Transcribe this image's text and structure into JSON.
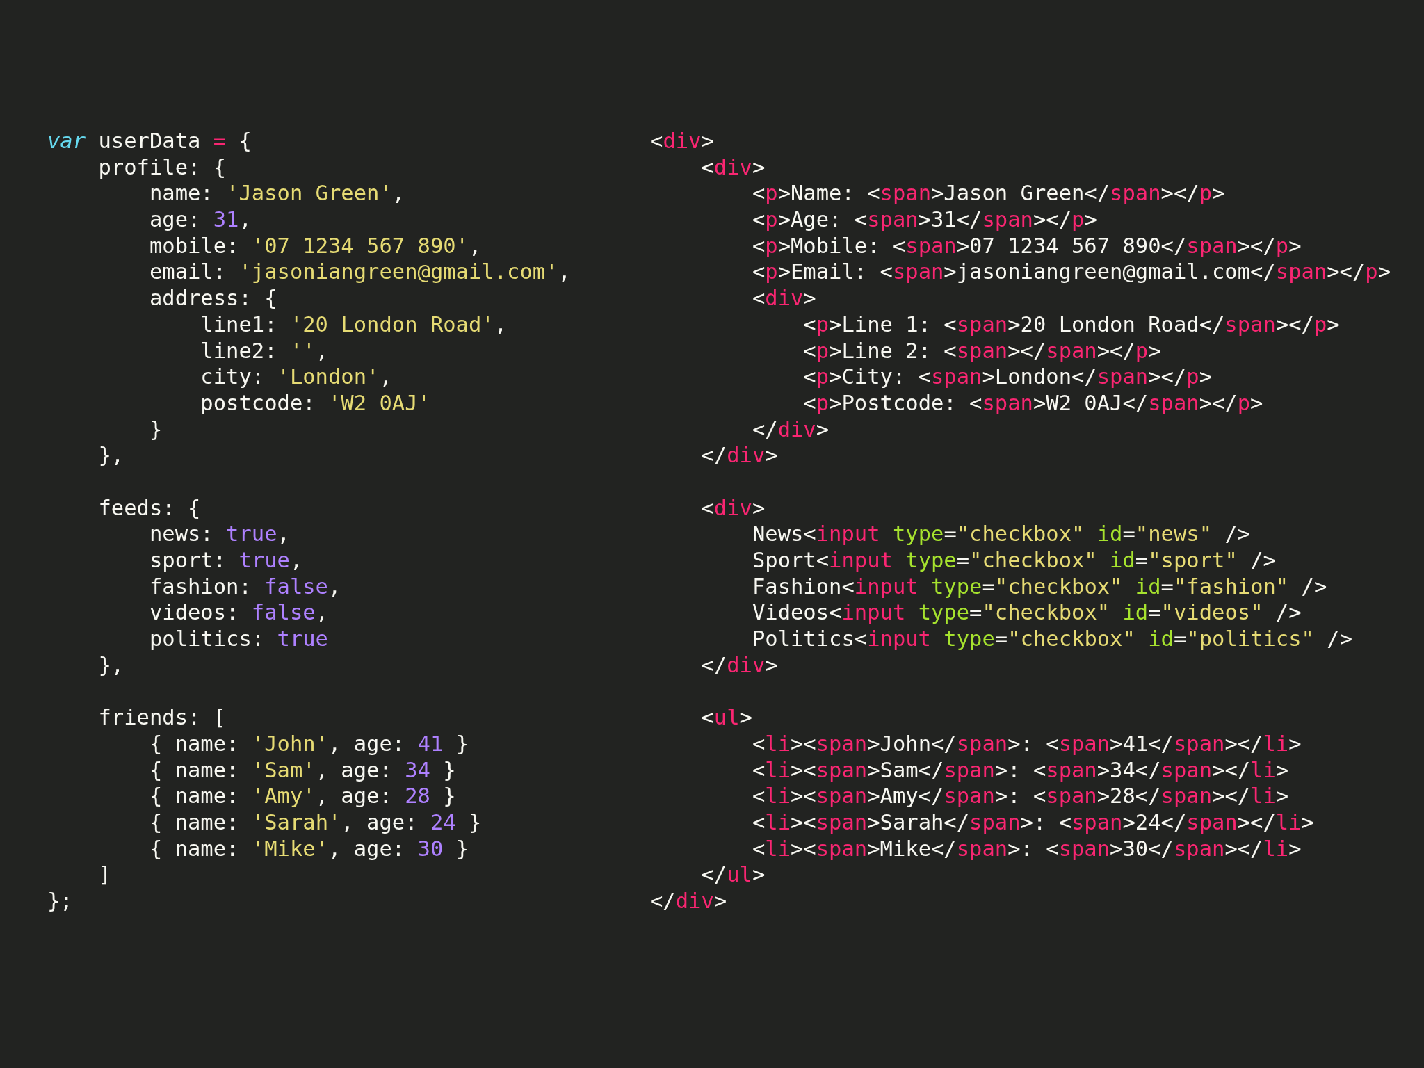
{
  "panes": [
    {
      "blocks": [
        {
          "lines": [
            {
              "tokens": [
                {
                  "kind": "keyword",
                  "text": "var"
                },
                {
                  "kind": "plain",
                  "text": " userData "
                },
                {
                  "kind": "operator",
                  "text": "="
                },
                {
                  "kind": "plain",
                  "text": " {"
                }
              ]
            },
            {
              "tokens": [
                {
                  "kind": "plain",
                  "text": "    profile: {"
                }
              ]
            },
            {
              "tokens": [
                {
                  "kind": "plain",
                  "text": "        name: "
                },
                {
                  "kind": "string",
                  "text": "'Jason Green'"
                },
                {
                  "kind": "plain",
                  "text": ","
                }
              ]
            },
            {
              "tokens": [
                {
                  "kind": "plain",
                  "text": "        age: "
                },
                {
                  "kind": "constant",
                  "text": "31"
                },
                {
                  "kind": "plain",
                  "text": ","
                }
              ]
            },
            {
              "tokens": [
                {
                  "kind": "plain",
                  "text": "        mobile: "
                },
                {
                  "kind": "string",
                  "text": "'07 1234 567 890'"
                },
                {
                  "kind": "plain",
                  "text": ","
                }
              ]
            },
            {
              "tokens": [
                {
                  "kind": "plain",
                  "text": "        email: "
                },
                {
                  "kind": "string",
                  "text": "'jasoniangreen@gmail.com'"
                },
                {
                  "kind": "plain",
                  "text": ","
                }
              ]
            },
            {
              "tokens": [
                {
                  "kind": "plain",
                  "text": "        address: {"
                }
              ]
            },
            {
              "tokens": [
                {
                  "kind": "plain",
                  "text": "            line1: "
                },
                {
                  "kind": "string",
                  "text": "'20 London Road'"
                },
                {
                  "kind": "plain",
                  "text": ","
                }
              ]
            },
            {
              "tokens": [
                {
                  "kind": "plain",
                  "text": "            line2: "
                },
                {
                  "kind": "string",
                  "text": "''"
                },
                {
                  "kind": "plain",
                  "text": ","
                }
              ]
            },
            {
              "tokens": [
                {
                  "kind": "plain",
                  "text": "            city: "
                },
                {
                  "kind": "string",
                  "text": "'London'"
                },
                {
                  "kind": "plain",
                  "text": ","
                }
              ]
            },
            {
              "tokens": [
                {
                  "kind": "plain",
                  "text": "            postcode: "
                },
                {
                  "kind": "string",
                  "text": "'W2 0AJ'"
                }
              ]
            },
            {
              "tokens": [
                {
                  "kind": "plain",
                  "text": "        }"
                }
              ]
            },
            {
              "tokens": [
                {
                  "kind": "plain",
                  "text": "    },"
                }
              ]
            }
          ]
        },
        {
          "lines": [
            {
              "tokens": [
                {
                  "kind": "plain",
                  "text": "    feeds: {"
                }
              ]
            },
            {
              "tokens": [
                {
                  "kind": "plain",
                  "text": "        news: "
                },
                {
                  "kind": "constant",
                  "text": "true"
                },
                {
                  "kind": "plain",
                  "text": ","
                }
              ]
            },
            {
              "tokens": [
                {
                  "kind": "plain",
                  "text": "        sport: "
                },
                {
                  "kind": "constant",
                  "text": "true"
                },
                {
                  "kind": "plain",
                  "text": ","
                }
              ]
            },
            {
              "tokens": [
                {
                  "kind": "plain",
                  "text": "        fashion: "
                },
                {
                  "kind": "constant",
                  "text": "false"
                },
                {
                  "kind": "plain",
                  "text": ","
                }
              ]
            },
            {
              "tokens": [
                {
                  "kind": "plain",
                  "text": "        videos: "
                },
                {
                  "kind": "constant",
                  "text": "false"
                },
                {
                  "kind": "plain",
                  "text": ","
                }
              ]
            },
            {
              "tokens": [
                {
                  "kind": "plain",
                  "text": "        politics: "
                },
                {
                  "kind": "constant",
                  "text": "true"
                }
              ]
            },
            {
              "tokens": [
                {
                  "kind": "plain",
                  "text": "    },"
                }
              ]
            }
          ]
        },
        {
          "lines": [
            {
              "tokens": [
                {
                  "kind": "plain",
                  "text": "    friends: ["
                }
              ]
            },
            {
              "tokens": [
                {
                  "kind": "plain",
                  "text": "        { name: "
                },
                {
                  "kind": "string",
                  "text": "'John'"
                },
                {
                  "kind": "plain",
                  "text": ", age: "
                },
                {
                  "kind": "constant",
                  "text": "41"
                },
                {
                  "kind": "plain",
                  "text": " }"
                }
              ]
            },
            {
              "tokens": [
                {
                  "kind": "plain",
                  "text": "        { name: "
                },
                {
                  "kind": "string",
                  "text": "'Sam'"
                },
                {
                  "kind": "plain",
                  "text": ", age: "
                },
                {
                  "kind": "constant",
                  "text": "34"
                },
                {
                  "kind": "plain",
                  "text": " }"
                }
              ]
            },
            {
              "tokens": [
                {
                  "kind": "plain",
                  "text": "        { name: "
                },
                {
                  "kind": "string",
                  "text": "'Amy'"
                },
                {
                  "kind": "plain",
                  "text": ", age: "
                },
                {
                  "kind": "constant",
                  "text": "28"
                },
                {
                  "kind": "plain",
                  "text": " }"
                }
              ]
            },
            {
              "tokens": [
                {
                  "kind": "plain",
                  "text": "        { name: "
                },
                {
                  "kind": "string",
                  "text": "'Sarah'"
                },
                {
                  "kind": "plain",
                  "text": ", age: "
                },
                {
                  "kind": "constant",
                  "text": "24"
                },
                {
                  "kind": "plain",
                  "text": " }"
                }
              ]
            },
            {
              "tokens": [
                {
                  "kind": "plain",
                  "text": "        { name: "
                },
                {
                  "kind": "string",
                  "text": "'Mike'"
                },
                {
                  "kind": "plain",
                  "text": ", age: "
                },
                {
                  "kind": "constant",
                  "text": "30"
                },
                {
                  "kind": "plain",
                  "text": " }"
                }
              ]
            },
            {
              "tokens": [
                {
                  "kind": "plain",
                  "text": "    ]"
                }
              ]
            },
            {
              "tokens": [
                {
                  "kind": "plain",
                  "text": "};"
                }
              ]
            }
          ]
        }
      ]
    },
    {
      "blocks": [
        {
          "lines": [
            {
              "tokens": [
                {
                  "kind": "plain",
                  "text": "<"
                },
                {
                  "kind": "tag",
                  "text": "div"
                },
                {
                  "kind": "plain",
                  "text": ">"
                }
              ]
            },
            {
              "tokens": [
                {
                  "kind": "plain",
                  "text": "    <"
                },
                {
                  "kind": "tag",
                  "text": "div"
                },
                {
                  "kind": "plain",
                  "text": ">"
                }
              ]
            },
            {
              "tokens": [
                {
                  "kind": "plain",
                  "text": "        <"
                },
                {
                  "kind": "tag",
                  "text": "p"
                },
                {
                  "kind": "plain",
                  "text": ">Name: <"
                },
                {
                  "kind": "tag",
                  "text": "span"
                },
                {
                  "kind": "plain",
                  "text": ">Jason Green</"
                },
                {
                  "kind": "tag",
                  "text": "span"
                },
                {
                  "kind": "plain",
                  "text": "></"
                },
                {
                  "kind": "tag",
                  "text": "p"
                },
                {
                  "kind": "plain",
                  "text": ">"
                }
              ]
            },
            {
              "tokens": [
                {
                  "kind": "plain",
                  "text": "        <"
                },
                {
                  "kind": "tag",
                  "text": "p"
                },
                {
                  "kind": "plain",
                  "text": ">Age: <"
                },
                {
                  "kind": "tag",
                  "text": "span"
                },
                {
                  "kind": "plain",
                  "text": ">31</"
                },
                {
                  "kind": "tag",
                  "text": "span"
                },
                {
                  "kind": "plain",
                  "text": "></"
                },
                {
                  "kind": "tag",
                  "text": "p"
                },
                {
                  "kind": "plain",
                  "text": ">"
                }
              ]
            },
            {
              "tokens": [
                {
                  "kind": "plain",
                  "text": "        <"
                },
                {
                  "kind": "tag",
                  "text": "p"
                },
                {
                  "kind": "plain",
                  "text": ">Mobile: <"
                },
                {
                  "kind": "tag",
                  "text": "span"
                },
                {
                  "kind": "plain",
                  "text": ">07 1234 567 890</"
                },
                {
                  "kind": "tag",
                  "text": "span"
                },
                {
                  "kind": "plain",
                  "text": "></"
                },
                {
                  "kind": "tag",
                  "text": "p"
                },
                {
                  "kind": "plain",
                  "text": ">"
                }
              ]
            },
            {
              "tokens": [
                {
                  "kind": "plain",
                  "text": "        <"
                },
                {
                  "kind": "tag",
                  "text": "p"
                },
                {
                  "kind": "plain",
                  "text": ">Email: <"
                },
                {
                  "kind": "tag",
                  "text": "span"
                },
                {
                  "kind": "plain",
                  "text": ">jasoniangreen@gmail.com</"
                },
                {
                  "kind": "tag",
                  "text": "span"
                },
                {
                  "kind": "plain",
                  "text": "></"
                },
                {
                  "kind": "tag",
                  "text": "p"
                },
                {
                  "kind": "plain",
                  "text": ">"
                }
              ]
            },
            {
              "tokens": [
                {
                  "kind": "plain",
                  "text": "        <"
                },
                {
                  "kind": "tag",
                  "text": "div"
                },
                {
                  "kind": "plain",
                  "text": ">"
                }
              ]
            },
            {
              "tokens": [
                {
                  "kind": "plain",
                  "text": "            <"
                },
                {
                  "kind": "tag",
                  "text": "p"
                },
                {
                  "kind": "plain",
                  "text": ">Line 1: <"
                },
                {
                  "kind": "tag",
                  "text": "span"
                },
                {
                  "kind": "plain",
                  "text": ">20 London Road</"
                },
                {
                  "kind": "tag",
                  "text": "span"
                },
                {
                  "kind": "plain",
                  "text": "></"
                },
                {
                  "kind": "tag",
                  "text": "p"
                },
                {
                  "kind": "plain",
                  "text": ">"
                }
              ]
            },
            {
              "tokens": [
                {
                  "kind": "plain",
                  "text": "            <"
                },
                {
                  "kind": "tag",
                  "text": "p"
                },
                {
                  "kind": "plain",
                  "text": ">Line 2: <"
                },
                {
                  "kind": "tag",
                  "text": "span"
                },
                {
                  "kind": "plain",
                  "text": "></"
                },
                {
                  "kind": "tag",
                  "text": "span"
                },
                {
                  "kind": "plain",
                  "text": "></"
                },
                {
                  "kind": "tag",
                  "text": "p"
                },
                {
                  "kind": "plain",
                  "text": ">"
                }
              ]
            },
            {
              "tokens": [
                {
                  "kind": "plain",
                  "text": "            <"
                },
                {
                  "kind": "tag",
                  "text": "p"
                },
                {
                  "kind": "plain",
                  "text": ">City: <"
                },
                {
                  "kind": "tag",
                  "text": "span"
                },
                {
                  "kind": "plain",
                  "text": ">London</"
                },
                {
                  "kind": "tag",
                  "text": "span"
                },
                {
                  "kind": "plain",
                  "text": "></"
                },
                {
                  "kind": "tag",
                  "text": "p"
                },
                {
                  "kind": "plain",
                  "text": ">"
                }
              ]
            },
            {
              "tokens": [
                {
                  "kind": "plain",
                  "text": "            <"
                },
                {
                  "kind": "tag",
                  "text": "p"
                },
                {
                  "kind": "plain",
                  "text": ">Postcode: <"
                },
                {
                  "kind": "tag",
                  "text": "span"
                },
                {
                  "kind": "plain",
                  "text": ">W2 0AJ</"
                },
                {
                  "kind": "tag",
                  "text": "span"
                },
                {
                  "kind": "plain",
                  "text": "></"
                },
                {
                  "kind": "tag",
                  "text": "p"
                },
                {
                  "kind": "plain",
                  "text": ">"
                }
              ]
            },
            {
              "tokens": [
                {
                  "kind": "plain",
                  "text": "        </"
                },
                {
                  "kind": "tag",
                  "text": "div"
                },
                {
                  "kind": "plain",
                  "text": ">"
                }
              ]
            },
            {
              "tokens": [
                {
                  "kind": "plain",
                  "text": "    </"
                },
                {
                  "kind": "tag",
                  "text": "div"
                },
                {
                  "kind": "plain",
                  "text": ">"
                }
              ]
            }
          ]
        },
        {
          "lines": [
            {
              "tokens": [
                {
                  "kind": "plain",
                  "text": "    <"
                },
                {
                  "kind": "tag",
                  "text": "div"
                },
                {
                  "kind": "plain",
                  "text": ">"
                }
              ]
            },
            {
              "tokens": [
                {
                  "kind": "plain",
                  "text": "        News<"
                },
                {
                  "kind": "tag",
                  "text": "input"
                },
                {
                  "kind": "attribute",
                  "text": " type"
                },
                {
                  "kind": "plain",
                  "text": "="
                },
                {
                  "kind": "string",
                  "text": "\"checkbox\""
                },
                {
                  "kind": "attribute",
                  "text": " id"
                },
                {
                  "kind": "plain",
                  "text": "="
                },
                {
                  "kind": "string",
                  "text": "\"news\""
                },
                {
                  "kind": "plain",
                  "text": " />"
                }
              ]
            },
            {
              "tokens": [
                {
                  "kind": "plain",
                  "text": "        Sport<"
                },
                {
                  "kind": "tag",
                  "text": "input"
                },
                {
                  "kind": "attribute",
                  "text": " type"
                },
                {
                  "kind": "plain",
                  "text": "="
                },
                {
                  "kind": "string",
                  "text": "\"checkbox\""
                },
                {
                  "kind": "attribute",
                  "text": " id"
                },
                {
                  "kind": "plain",
                  "text": "="
                },
                {
                  "kind": "string",
                  "text": "\"sport\""
                },
                {
                  "kind": "plain",
                  "text": " />"
                }
              ]
            },
            {
              "tokens": [
                {
                  "kind": "plain",
                  "text": "        Fashion<"
                },
                {
                  "kind": "tag",
                  "text": "input"
                },
                {
                  "kind": "attribute",
                  "text": " type"
                },
                {
                  "kind": "plain",
                  "text": "="
                },
                {
                  "kind": "string",
                  "text": "\"checkbox\""
                },
                {
                  "kind": "attribute",
                  "text": " id"
                },
                {
                  "kind": "plain",
                  "text": "="
                },
                {
                  "kind": "string",
                  "text": "\"fashion\""
                },
                {
                  "kind": "plain",
                  "text": " />"
                }
              ]
            },
            {
              "tokens": [
                {
                  "kind": "plain",
                  "text": "        Videos<"
                },
                {
                  "kind": "tag",
                  "text": "input"
                },
                {
                  "kind": "attribute",
                  "text": " type"
                },
                {
                  "kind": "plain",
                  "text": "="
                },
                {
                  "kind": "string",
                  "text": "\"checkbox\""
                },
                {
                  "kind": "attribute",
                  "text": " id"
                },
                {
                  "kind": "plain",
                  "text": "="
                },
                {
                  "kind": "string",
                  "text": "\"videos\""
                },
                {
                  "kind": "plain",
                  "text": " />"
                }
              ]
            },
            {
              "tokens": [
                {
                  "kind": "plain",
                  "text": "        Politics<"
                },
                {
                  "kind": "tag",
                  "text": "input"
                },
                {
                  "kind": "attribute",
                  "text": " type"
                },
                {
                  "kind": "plain",
                  "text": "="
                },
                {
                  "kind": "string",
                  "text": "\"checkbox\""
                },
                {
                  "kind": "attribute",
                  "text": " id"
                },
                {
                  "kind": "plain",
                  "text": "="
                },
                {
                  "kind": "string",
                  "text": "\"politics\""
                },
                {
                  "kind": "plain",
                  "text": " />"
                }
              ]
            },
            {
              "tokens": [
                {
                  "kind": "plain",
                  "text": "    </"
                },
                {
                  "kind": "tag",
                  "text": "div"
                },
                {
                  "kind": "plain",
                  "text": ">"
                }
              ]
            }
          ]
        },
        {
          "lines": [
            {
              "tokens": [
                {
                  "kind": "plain",
                  "text": "    <"
                },
                {
                  "kind": "tag",
                  "text": "ul"
                },
                {
                  "kind": "plain",
                  "text": ">"
                }
              ]
            },
            {
              "tokens": [
                {
                  "kind": "plain",
                  "text": "        <"
                },
                {
                  "kind": "tag",
                  "text": "li"
                },
                {
                  "kind": "plain",
                  "text": "><"
                },
                {
                  "kind": "tag",
                  "text": "span"
                },
                {
                  "kind": "plain",
                  "text": ">John</"
                },
                {
                  "kind": "tag",
                  "text": "span"
                },
                {
                  "kind": "plain",
                  "text": ">: <"
                },
                {
                  "kind": "tag",
                  "text": "span"
                },
                {
                  "kind": "plain",
                  "text": ">41</"
                },
                {
                  "kind": "tag",
                  "text": "span"
                },
                {
                  "kind": "plain",
                  "text": "></"
                },
                {
                  "kind": "tag",
                  "text": "li"
                },
                {
                  "kind": "plain",
                  "text": ">"
                }
              ]
            },
            {
              "tokens": [
                {
                  "kind": "plain",
                  "text": "        <"
                },
                {
                  "kind": "tag",
                  "text": "li"
                },
                {
                  "kind": "plain",
                  "text": "><"
                },
                {
                  "kind": "tag",
                  "text": "span"
                },
                {
                  "kind": "plain",
                  "text": ">Sam</"
                },
                {
                  "kind": "tag",
                  "text": "span"
                },
                {
                  "kind": "plain",
                  "text": ">: <"
                },
                {
                  "kind": "tag",
                  "text": "span"
                },
                {
                  "kind": "plain",
                  "text": ">34</"
                },
                {
                  "kind": "tag",
                  "text": "span"
                },
                {
                  "kind": "plain",
                  "text": "></"
                },
                {
                  "kind": "tag",
                  "text": "li"
                },
                {
                  "kind": "plain",
                  "text": ">"
                }
              ]
            },
            {
              "tokens": [
                {
                  "kind": "plain",
                  "text": "        <"
                },
                {
                  "kind": "tag",
                  "text": "li"
                },
                {
                  "kind": "plain",
                  "text": "><"
                },
                {
                  "kind": "tag",
                  "text": "span"
                },
                {
                  "kind": "plain",
                  "text": ">Amy</"
                },
                {
                  "kind": "tag",
                  "text": "span"
                },
                {
                  "kind": "plain",
                  "text": ">: <"
                },
                {
                  "kind": "tag",
                  "text": "span"
                },
                {
                  "kind": "plain",
                  "text": ">28</"
                },
                {
                  "kind": "tag",
                  "text": "span"
                },
                {
                  "kind": "plain",
                  "text": "></"
                },
                {
                  "kind": "tag",
                  "text": "li"
                },
                {
                  "kind": "plain",
                  "text": ">"
                }
              ]
            },
            {
              "tokens": [
                {
                  "kind": "plain",
                  "text": "        <"
                },
                {
                  "kind": "tag",
                  "text": "li"
                },
                {
                  "kind": "plain",
                  "text": "><"
                },
                {
                  "kind": "tag",
                  "text": "span"
                },
                {
                  "kind": "plain",
                  "text": ">Sarah</"
                },
                {
                  "kind": "tag",
                  "text": "span"
                },
                {
                  "kind": "plain",
                  "text": ">: <"
                },
                {
                  "kind": "tag",
                  "text": "span"
                },
                {
                  "kind": "plain",
                  "text": ">24</"
                },
                {
                  "kind": "tag",
                  "text": "span"
                },
                {
                  "kind": "plain",
                  "text": "></"
                },
                {
                  "kind": "tag",
                  "text": "li"
                },
                {
                  "kind": "plain",
                  "text": ">"
                }
              ]
            },
            {
              "tokens": [
                {
                  "kind": "plain",
                  "text": "        <"
                },
                {
                  "kind": "tag",
                  "text": "li"
                },
                {
                  "kind": "plain",
                  "text": "><"
                },
                {
                  "kind": "tag",
                  "text": "span"
                },
                {
                  "kind": "plain",
                  "text": ">Mike</"
                },
                {
                  "kind": "tag",
                  "text": "span"
                },
                {
                  "kind": "plain",
                  "text": ">: <"
                },
                {
                  "kind": "tag",
                  "text": "span"
                },
                {
                  "kind": "plain",
                  "text": ">30</"
                },
                {
                  "kind": "tag",
                  "text": "span"
                },
                {
                  "kind": "plain",
                  "text": "></"
                },
                {
                  "kind": "tag",
                  "text": "li"
                },
                {
                  "kind": "plain",
                  "text": ">"
                }
              ]
            },
            {
              "tokens": [
                {
                  "kind": "plain",
                  "text": "    </"
                },
                {
                  "kind": "tag",
                  "text": "ul"
                },
                {
                  "kind": "plain",
                  "text": ">"
                }
              ]
            },
            {
              "tokens": [
                {
                  "kind": "plain",
                  "text": "</"
                },
                {
                  "kind": "tag",
                  "text": "div"
                },
                {
                  "kind": "plain",
                  "text": ">"
                }
              ]
            }
          ]
        }
      ]
    }
  ]
}
